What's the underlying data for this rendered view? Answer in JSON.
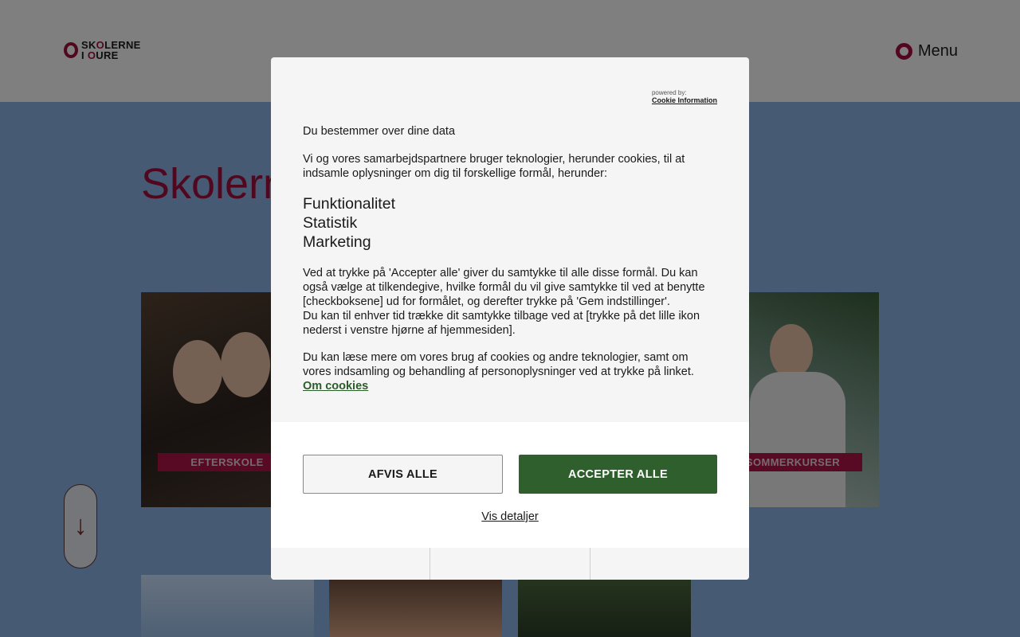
{
  "page": {
    "logo": {
      "line1_pre": "SK",
      "line1_o": "O",
      "line1_post": "LERNE",
      "line2_pre": "I ",
      "line2_o": "O",
      "line2_post": "URE"
    },
    "menu_label": "Menu",
    "hero_title": "Skolern",
    "cards": [
      {
        "label": "EFTERSKOLE"
      },
      {
        "label": "SOMMERKURSER"
      }
    ],
    "colors": {
      "brand": "#a3103c",
      "accept": "#2f5f2d",
      "hero_bg": "#8fb4e8"
    }
  },
  "cookie_dialog": {
    "powered_by": "powered by:",
    "powered_link": "Cookie Information",
    "title": "Du bestemmer over dine data",
    "intro": "Vi og vores samarbejdspartnere bruger teknologier, herunder cookies, til at indsamle oplysninger om dig til forskellige formål, herunder:",
    "purposes": [
      "Funktionalitet",
      "Statistik",
      "Marketing"
    ],
    "consent_text": "Ved at trykke på 'Accepter alle' giver du samtykke til alle disse formål. Du kan også vælge at tilkendegive, hvilke formål du vil give samtykke til ved at benytte [checkboksene] ud for formålet, og derefter trykke på 'Gem indstillinger'.",
    "revoke_text": "Du kan til enhver tid trække dit samtykke tilbage ved at [trykke på det lille ikon nederst i venstre hjørne af hjemmesiden].",
    "more_text": "Du kan læse mere om vores brug af cookies og andre teknologier, samt om vores indsamling og behandling af personoplysninger ved at trykke på linket.",
    "more_link": "Om cookies",
    "reject_label": "AFVIS ALLE",
    "accept_label": "ACCEPTER ALLE",
    "details_label": "Vis detaljer"
  }
}
